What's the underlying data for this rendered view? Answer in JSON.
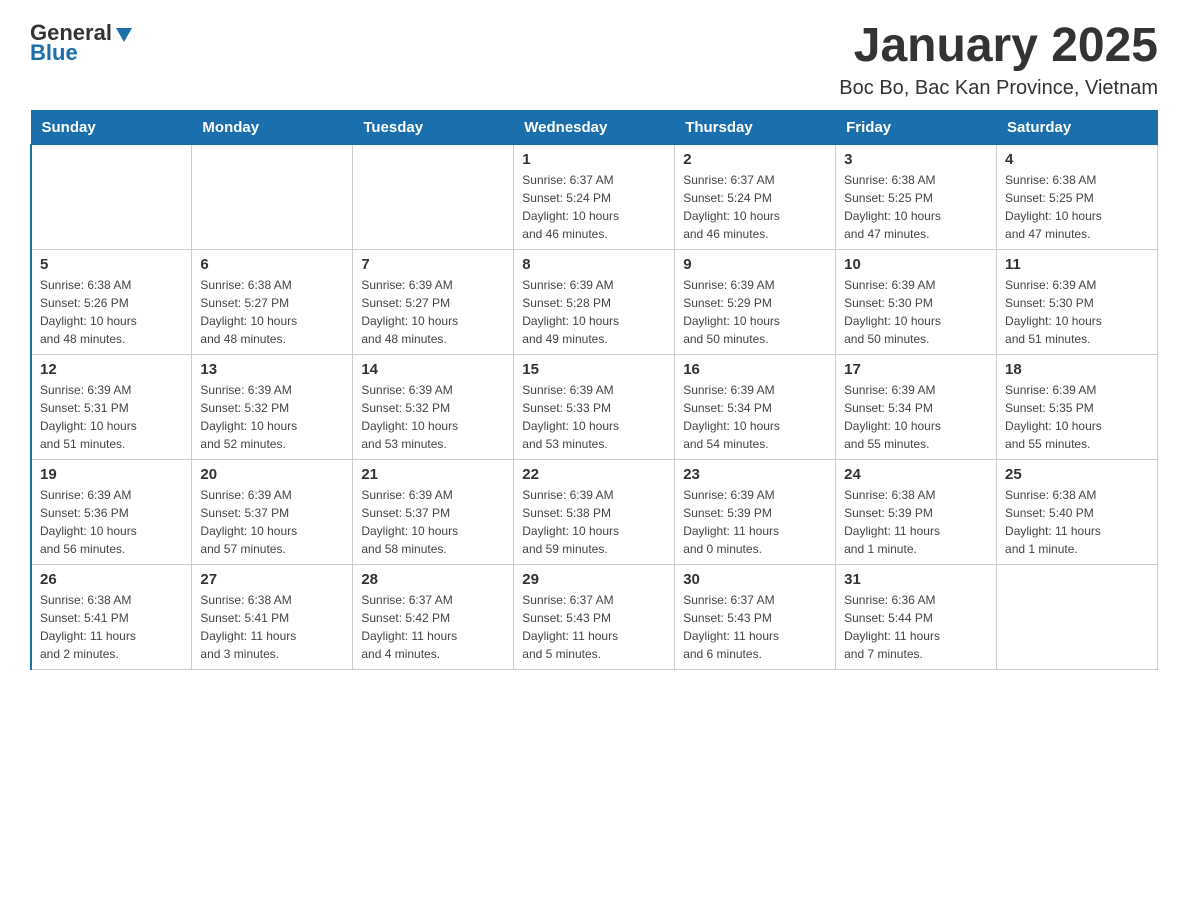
{
  "header": {
    "logo_general": "General",
    "logo_blue": "Blue",
    "title": "January 2025",
    "subtitle": "Boc Bo, Bac Kan Province, Vietnam"
  },
  "days_of_week": [
    "Sunday",
    "Monday",
    "Tuesday",
    "Wednesday",
    "Thursday",
    "Friday",
    "Saturday"
  ],
  "weeks": [
    [
      {
        "day": "",
        "info": ""
      },
      {
        "day": "",
        "info": ""
      },
      {
        "day": "",
        "info": ""
      },
      {
        "day": "1",
        "info": "Sunrise: 6:37 AM\nSunset: 5:24 PM\nDaylight: 10 hours\nand 46 minutes."
      },
      {
        "day": "2",
        "info": "Sunrise: 6:37 AM\nSunset: 5:24 PM\nDaylight: 10 hours\nand 46 minutes."
      },
      {
        "day": "3",
        "info": "Sunrise: 6:38 AM\nSunset: 5:25 PM\nDaylight: 10 hours\nand 47 minutes."
      },
      {
        "day": "4",
        "info": "Sunrise: 6:38 AM\nSunset: 5:25 PM\nDaylight: 10 hours\nand 47 minutes."
      }
    ],
    [
      {
        "day": "5",
        "info": "Sunrise: 6:38 AM\nSunset: 5:26 PM\nDaylight: 10 hours\nand 48 minutes."
      },
      {
        "day": "6",
        "info": "Sunrise: 6:38 AM\nSunset: 5:27 PM\nDaylight: 10 hours\nand 48 minutes."
      },
      {
        "day": "7",
        "info": "Sunrise: 6:39 AM\nSunset: 5:27 PM\nDaylight: 10 hours\nand 48 minutes."
      },
      {
        "day": "8",
        "info": "Sunrise: 6:39 AM\nSunset: 5:28 PM\nDaylight: 10 hours\nand 49 minutes."
      },
      {
        "day": "9",
        "info": "Sunrise: 6:39 AM\nSunset: 5:29 PM\nDaylight: 10 hours\nand 50 minutes."
      },
      {
        "day": "10",
        "info": "Sunrise: 6:39 AM\nSunset: 5:30 PM\nDaylight: 10 hours\nand 50 minutes."
      },
      {
        "day": "11",
        "info": "Sunrise: 6:39 AM\nSunset: 5:30 PM\nDaylight: 10 hours\nand 51 minutes."
      }
    ],
    [
      {
        "day": "12",
        "info": "Sunrise: 6:39 AM\nSunset: 5:31 PM\nDaylight: 10 hours\nand 51 minutes."
      },
      {
        "day": "13",
        "info": "Sunrise: 6:39 AM\nSunset: 5:32 PM\nDaylight: 10 hours\nand 52 minutes."
      },
      {
        "day": "14",
        "info": "Sunrise: 6:39 AM\nSunset: 5:32 PM\nDaylight: 10 hours\nand 53 minutes."
      },
      {
        "day": "15",
        "info": "Sunrise: 6:39 AM\nSunset: 5:33 PM\nDaylight: 10 hours\nand 53 minutes."
      },
      {
        "day": "16",
        "info": "Sunrise: 6:39 AM\nSunset: 5:34 PM\nDaylight: 10 hours\nand 54 minutes."
      },
      {
        "day": "17",
        "info": "Sunrise: 6:39 AM\nSunset: 5:34 PM\nDaylight: 10 hours\nand 55 minutes."
      },
      {
        "day": "18",
        "info": "Sunrise: 6:39 AM\nSunset: 5:35 PM\nDaylight: 10 hours\nand 55 minutes."
      }
    ],
    [
      {
        "day": "19",
        "info": "Sunrise: 6:39 AM\nSunset: 5:36 PM\nDaylight: 10 hours\nand 56 minutes."
      },
      {
        "day": "20",
        "info": "Sunrise: 6:39 AM\nSunset: 5:37 PM\nDaylight: 10 hours\nand 57 minutes."
      },
      {
        "day": "21",
        "info": "Sunrise: 6:39 AM\nSunset: 5:37 PM\nDaylight: 10 hours\nand 58 minutes."
      },
      {
        "day": "22",
        "info": "Sunrise: 6:39 AM\nSunset: 5:38 PM\nDaylight: 10 hours\nand 59 minutes."
      },
      {
        "day": "23",
        "info": "Sunrise: 6:39 AM\nSunset: 5:39 PM\nDaylight: 11 hours\nand 0 minutes."
      },
      {
        "day": "24",
        "info": "Sunrise: 6:38 AM\nSunset: 5:39 PM\nDaylight: 11 hours\nand 1 minute."
      },
      {
        "day": "25",
        "info": "Sunrise: 6:38 AM\nSunset: 5:40 PM\nDaylight: 11 hours\nand 1 minute."
      }
    ],
    [
      {
        "day": "26",
        "info": "Sunrise: 6:38 AM\nSunset: 5:41 PM\nDaylight: 11 hours\nand 2 minutes."
      },
      {
        "day": "27",
        "info": "Sunrise: 6:38 AM\nSunset: 5:41 PM\nDaylight: 11 hours\nand 3 minutes."
      },
      {
        "day": "28",
        "info": "Sunrise: 6:37 AM\nSunset: 5:42 PM\nDaylight: 11 hours\nand 4 minutes."
      },
      {
        "day": "29",
        "info": "Sunrise: 6:37 AM\nSunset: 5:43 PM\nDaylight: 11 hours\nand 5 minutes."
      },
      {
        "day": "30",
        "info": "Sunrise: 6:37 AM\nSunset: 5:43 PM\nDaylight: 11 hours\nand 6 minutes."
      },
      {
        "day": "31",
        "info": "Sunrise: 6:36 AM\nSunset: 5:44 PM\nDaylight: 11 hours\nand 7 minutes."
      },
      {
        "day": "",
        "info": ""
      }
    ]
  ]
}
